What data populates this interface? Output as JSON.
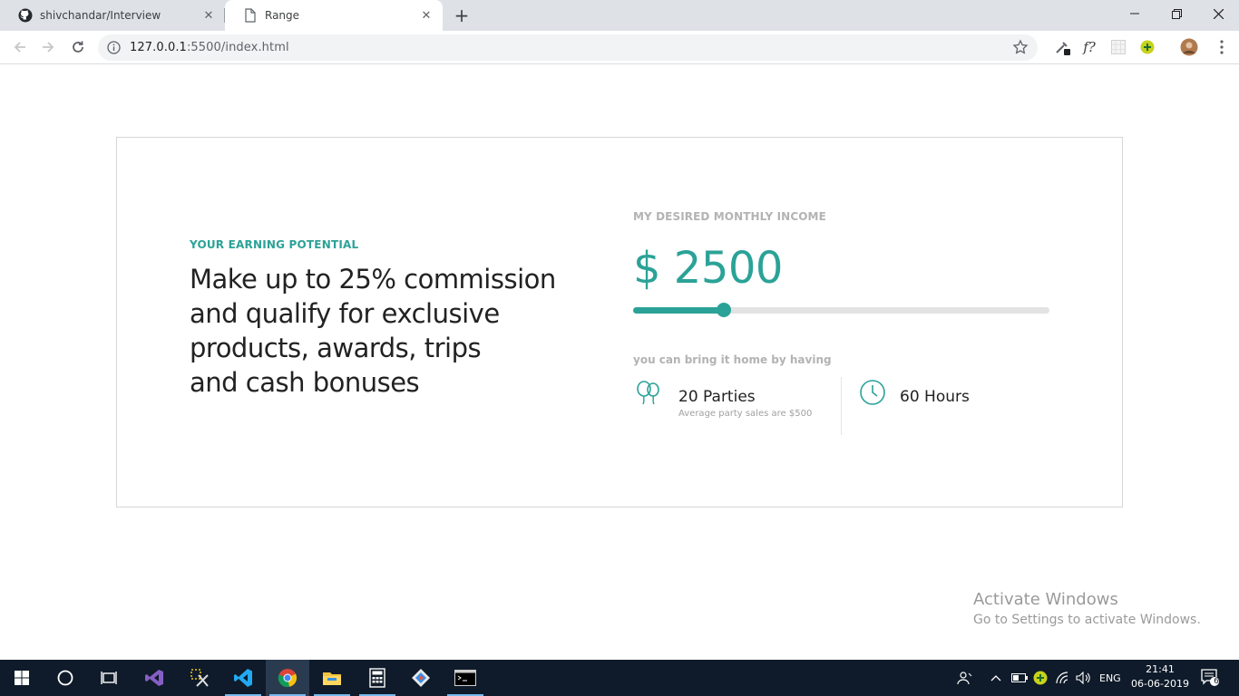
{
  "browser": {
    "tabs": [
      {
        "title": "shivchandar/Interview",
        "icon": "github-icon"
      },
      {
        "title": "Range",
        "icon": "page-icon"
      }
    ],
    "url_host": "127.0.0.1",
    "url_rest": ":5500/index.html",
    "extensions": [
      "eyedropper-icon",
      "font-detect-icon",
      "grid-ext-icon",
      "green-circle-ext-icon",
      "profile-avatar"
    ]
  },
  "page": {
    "eyebrow": "YOUR EARNING POTENTIAL",
    "headline_lines": [
      "Make up to 25% commission",
      "and qualify for exclusive",
      "products, awards, trips",
      "and cash bonuses"
    ],
    "income_label": "MY DESIRED MONTHLY INCOME",
    "amount": "$ 2500",
    "slider_fraction": 0.218,
    "bring_label": "you can bring it home by having",
    "parties": {
      "main": "20 Parties",
      "sub": "Average party sales are $500"
    },
    "hours": {
      "main": "60 Hours"
    },
    "accent_color": "#2ba297"
  },
  "watermark": {
    "line1": "Activate Windows",
    "line2": "Go to Settings to activate Windows."
  },
  "taskbar": {
    "apps": [
      "windows-start-icon",
      "cortana-icon",
      "task-view-icon",
      "visual-studio-icon",
      "snipping-tool-icon",
      "vscode-icon",
      "chrome-icon",
      "file-explorer-icon",
      "calculator-icon",
      "git-icon",
      "terminal-icon"
    ],
    "lang": "ENG",
    "time": "21:41",
    "date": "06-06-2019",
    "notifications": "6"
  }
}
